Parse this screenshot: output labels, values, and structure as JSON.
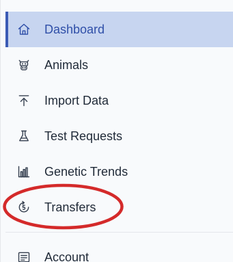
{
  "sidebar": {
    "items": [
      {
        "label": "Dashboard",
        "icon": "home-icon",
        "active": true
      },
      {
        "label": "Animals",
        "icon": "cow-icon",
        "active": false
      },
      {
        "label": "Import Data",
        "icon": "upload-icon",
        "active": false
      },
      {
        "label": "Test Requests",
        "icon": "flask-icon",
        "active": false
      },
      {
        "label": "Genetic Trends",
        "icon": "bar-chart-icon",
        "active": false
      },
      {
        "label": "Transfers",
        "icon": "transfer-icon",
        "active": false
      }
    ],
    "account": {
      "label": "Account",
      "icon": "account-card-icon"
    }
  },
  "colors": {
    "active_background": "#c7d5f0",
    "active_accent": "#3b5bb5",
    "annotation_red": "#d42a2a"
  }
}
